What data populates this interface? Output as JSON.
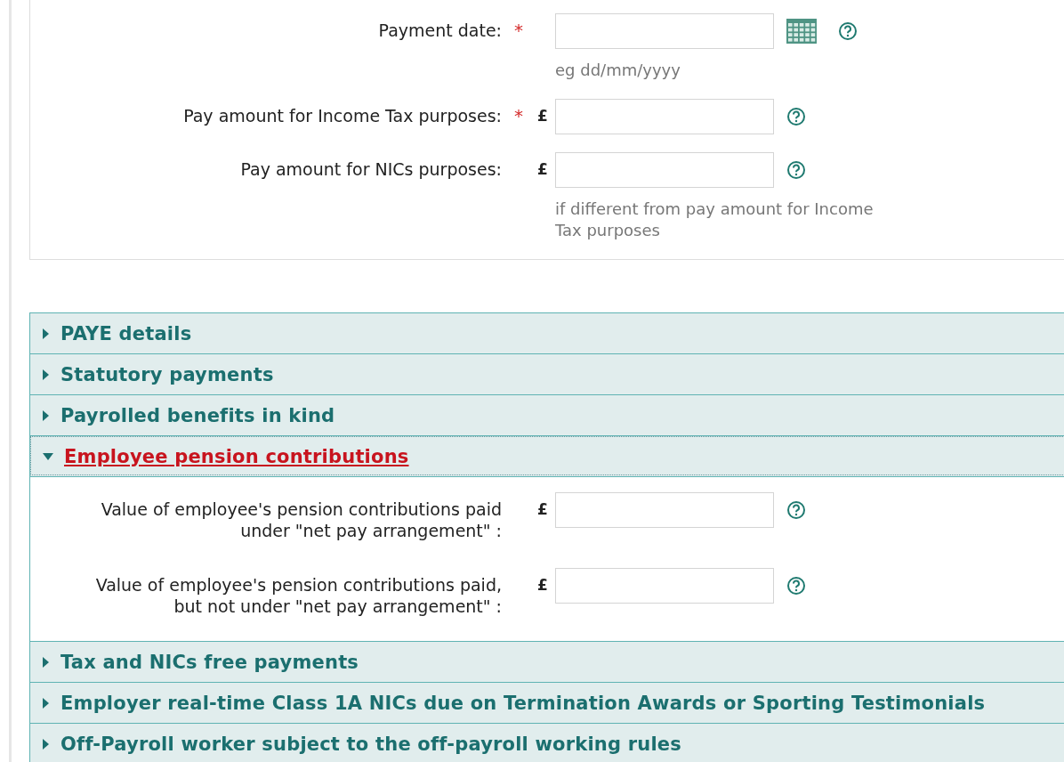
{
  "payment_fields": [
    {
      "label": "Payment date:",
      "required_mark": "*",
      "calendar": true,
      "hint": "eg dd/mm/yyyy"
    },
    {
      "label": "Pay amount for Income Tax purposes:",
      "required_mark": "*",
      "prefix": "£"
    },
    {
      "label": "Pay amount for NICs purposes:",
      "prefix": "£",
      "hint": "if different from pay amount for Income Tax purposes"
    }
  ],
  "sections": [
    {
      "title": "PAYE details",
      "expanded": false
    },
    {
      "title": "Statutory payments",
      "expanded": false
    },
    {
      "title": "Payrolled benefits in kind",
      "expanded": false
    },
    {
      "title": "Employee pension contributions",
      "expanded": true,
      "fields": [
        {
          "label": "Value of employee's pension contributions paid under \"net pay arrangement\" :",
          "prefix": "£"
        },
        {
          "label": "Value of employee's pension contributions paid, but not under \"net pay arrangement\" :",
          "prefix": "£"
        }
      ]
    },
    {
      "title": "Tax and NICs free payments",
      "expanded": false
    },
    {
      "title": "Employer real-time Class 1A NICs due on Termination Awards or Sporting Testimonials",
      "expanded": false
    },
    {
      "title": "Off-Payroll worker subject to the off-payroll working rules",
      "expanded": false
    }
  ]
}
